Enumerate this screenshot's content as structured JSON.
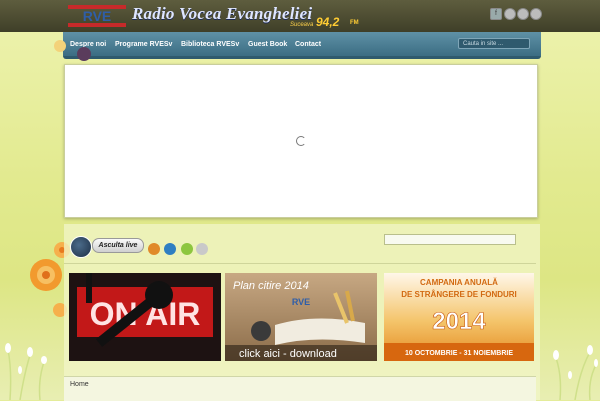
{
  "header": {
    "logo_text": "RVE",
    "title": "Radio Vocea Evangheliei",
    "city": "Suceava",
    "frequency": "94,2",
    "band": "FM",
    "social": [
      "facebook-icon",
      "rss-icon",
      "email-icon",
      "share-icon"
    ]
  },
  "nav": {
    "items": [
      "Despre noi",
      "Programe RVESv",
      "Biblioteca RVESv",
      "Guest Book",
      "Contact"
    ],
    "search_placeholder": "Cauta in site ..."
  },
  "player": {
    "listen_label": "Asculta live",
    "players": [
      "winamp-icon",
      "windows-media-icon",
      "android-icon",
      "apple-icon"
    ]
  },
  "banners": {
    "onair": "ON AIR",
    "plan_title": "Plan citire 2014",
    "plan_logo": "RVE",
    "plan_action": "click aici - download",
    "campaign_line1": "CAMPANIA ANUALĂ",
    "campaign_line2": "DE STRÂNGERE DE FONDURI",
    "campaign_year": "2014",
    "campaign_dates": "10 OCTOMBRIE - 31 NOIEMBRIE"
  },
  "breadcrumb": {
    "home": "Home"
  },
  "colors": {
    "nav": "#3b6d83",
    "topbar": "#3f3f28",
    "background": "#e2ea8f",
    "freq": "#ffcc33"
  }
}
